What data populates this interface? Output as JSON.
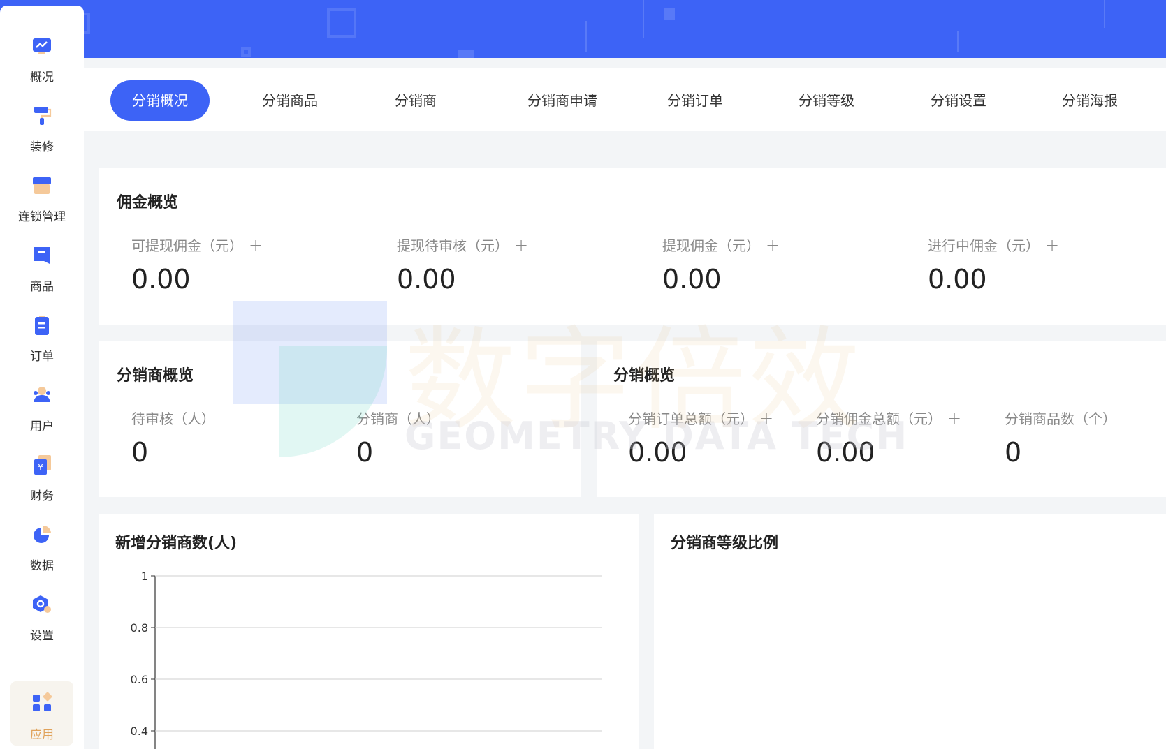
{
  "sidebar": {
    "items": [
      {
        "label": "概况",
        "icon": "chart-icon"
      },
      {
        "label": "装修",
        "icon": "paint-roller-icon"
      },
      {
        "label": "连锁管理",
        "icon": "store-icon"
      },
      {
        "label": "商品",
        "icon": "product-icon"
      },
      {
        "label": "订单",
        "icon": "order-icon"
      },
      {
        "label": "用户",
        "icon": "user-icon"
      },
      {
        "label": "财务",
        "icon": "finance-icon"
      },
      {
        "label": "数据",
        "icon": "pie-icon"
      },
      {
        "label": "设置",
        "icon": "settings-icon"
      },
      {
        "label": "应用",
        "icon": "apps-icon"
      }
    ],
    "active_index": 9
  },
  "tabs": [
    {
      "label": "分销概况"
    },
    {
      "label": "分销商品"
    },
    {
      "label": "分销商"
    },
    {
      "label": "分销商申请"
    },
    {
      "label": "分销订单"
    },
    {
      "label": "分销等级"
    },
    {
      "label": "分销设置"
    },
    {
      "label": "分销海报"
    }
  ],
  "commission": {
    "title": "佣金概览",
    "stats": [
      {
        "label": "可提现佣金（元）",
        "value": "0.00"
      },
      {
        "label": "提现待审核（元）",
        "value": "0.00"
      },
      {
        "label": "提现佣金（元）",
        "value": "0.00"
      },
      {
        "label": "进行中佣金（元）",
        "value": "0.00"
      }
    ]
  },
  "distributor_overview": {
    "title": "分销商概览",
    "stats": [
      {
        "label": "待审核（人）",
        "value": "0"
      },
      {
        "label": "分销商（人）",
        "value": "0"
      }
    ]
  },
  "distribution_overview": {
    "title": "分销概览",
    "stats": [
      {
        "label": "分销订单总额（元）",
        "value": "0.00"
      },
      {
        "label": "分销佣金总额（元）",
        "value": "0.00"
      },
      {
        "label": "分销商品数（个）",
        "value": "0"
      }
    ]
  },
  "new_distributors": {
    "title": "新增分销商数(人)"
  },
  "level_ratio": {
    "title": "分销商等级比例"
  },
  "watermark": {
    "text": "数字倍效",
    "subtext": "GEOMETRY DATA TECH"
  },
  "chart_data": {
    "type": "line",
    "title": "新增分销商数(人)",
    "y_ticks": [
      "1",
      "0.8",
      "0.6",
      "0.4"
    ],
    "ylim": [
      0.4,
      1
    ],
    "grid": true,
    "series": []
  },
  "colors": {
    "brand": "#3d63f6",
    "accent": "#e0a25a"
  }
}
